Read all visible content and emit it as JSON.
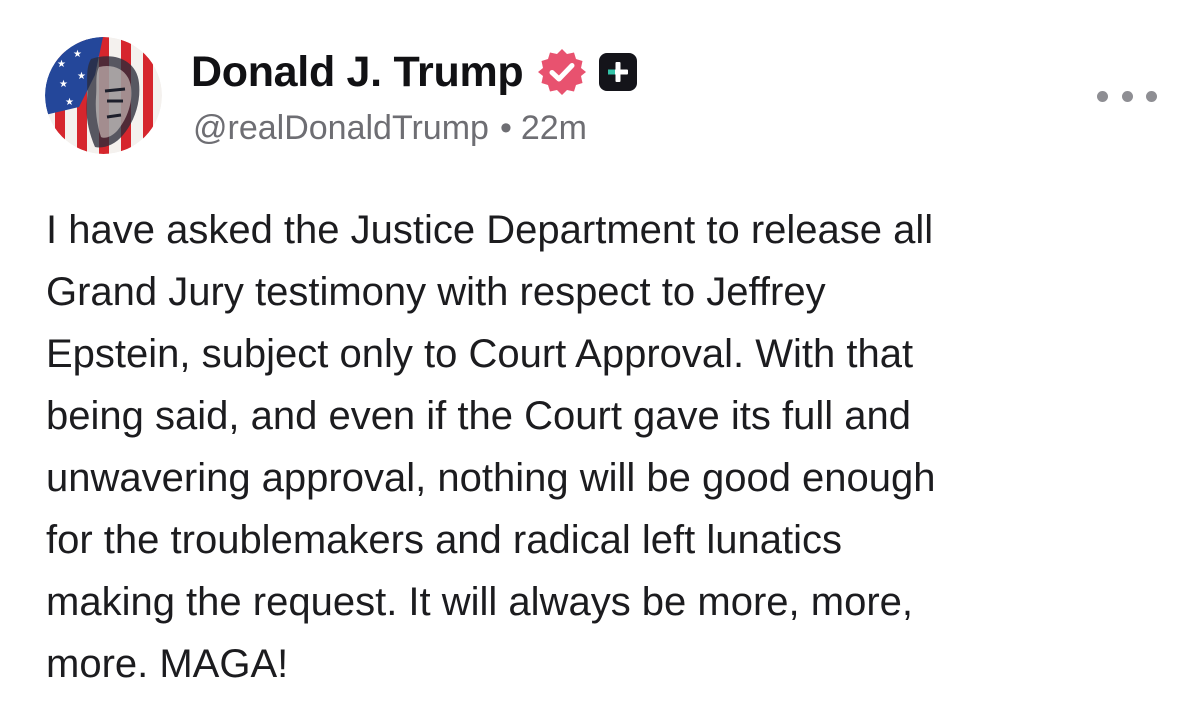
{
  "author": {
    "name": "Donald J. Trump",
    "handle": "@realDonaldTrump",
    "separator": "•",
    "timestamp": "22m",
    "verified_badge_color": "#e8526f",
    "plus_badge_color": "#14141a"
  },
  "icons": {
    "verified": "verified-badge-icon",
    "plus": "plus-badge-icon",
    "more": "more-options-icon",
    "avatar": "profile-avatar"
  },
  "post": {
    "lines": [
      "I have asked the Justice Department to release all",
      "Grand Jury testimony with respect to Jeffrey",
      "Epstein, subject only to Court Approval. With that",
      "being said, and even if the Court gave its full and",
      "unwavering approval, nothing will be good enough",
      "for the troublemakers and radical left lunatics",
      "making the request. It will always be more, more,",
      "more. MAGA!"
    ]
  }
}
